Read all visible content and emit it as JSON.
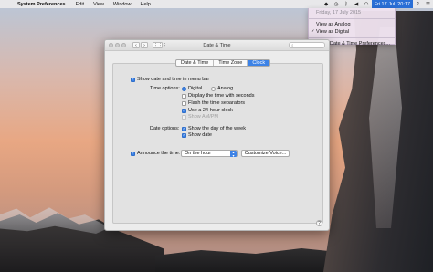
{
  "menubar": {
    "app_name": "System Preferences",
    "items": [
      "Edit",
      "View",
      "Window",
      "Help"
    ],
    "clock": {
      "date": "Fri 17 Jul",
      "time": "20:17"
    }
  },
  "dropdown": {
    "date_header": "Friday, 17 July 2015",
    "items": [
      "View as Analog",
      "View as Digital"
    ],
    "checked_item": "View as Digital",
    "open_prefs": "Open Date & Time Preferences..."
  },
  "window": {
    "title": "Date & Time",
    "tabs": [
      "Date & Time",
      "Time Zone",
      "Clock"
    ],
    "active_tab": "Clock",
    "show_in_menu_bar": {
      "label": "Show date and time in menu bar",
      "checked": true
    },
    "time_options": {
      "label": "Time options:",
      "digital": "Digital",
      "analog": "Analog",
      "selected": "Digital",
      "show_seconds": {
        "label": "Display the time with seconds",
        "checked": false
      },
      "flash_separators": {
        "label": "Flash the time separators",
        "checked": false
      },
      "use_24_hour": {
        "label": "Use a 24-hour clock",
        "checked": true
      },
      "show_ampm": {
        "label": "Show AM/PM",
        "checked": false,
        "enabled": false
      }
    },
    "date_options": {
      "label": "Date options:",
      "show_day_of_week": {
        "label": "Show the day of the week",
        "checked": true
      },
      "show_date": {
        "label": "Show date",
        "checked": true
      }
    },
    "announce": {
      "label": "Announce the time:",
      "checked": true,
      "interval": "On the hour",
      "customize_button": "Customize Voice..."
    },
    "help_label": "?"
  },
  "colors": {
    "accent": "#3c82e6",
    "menubar_highlight": "#2a6fd6"
  }
}
